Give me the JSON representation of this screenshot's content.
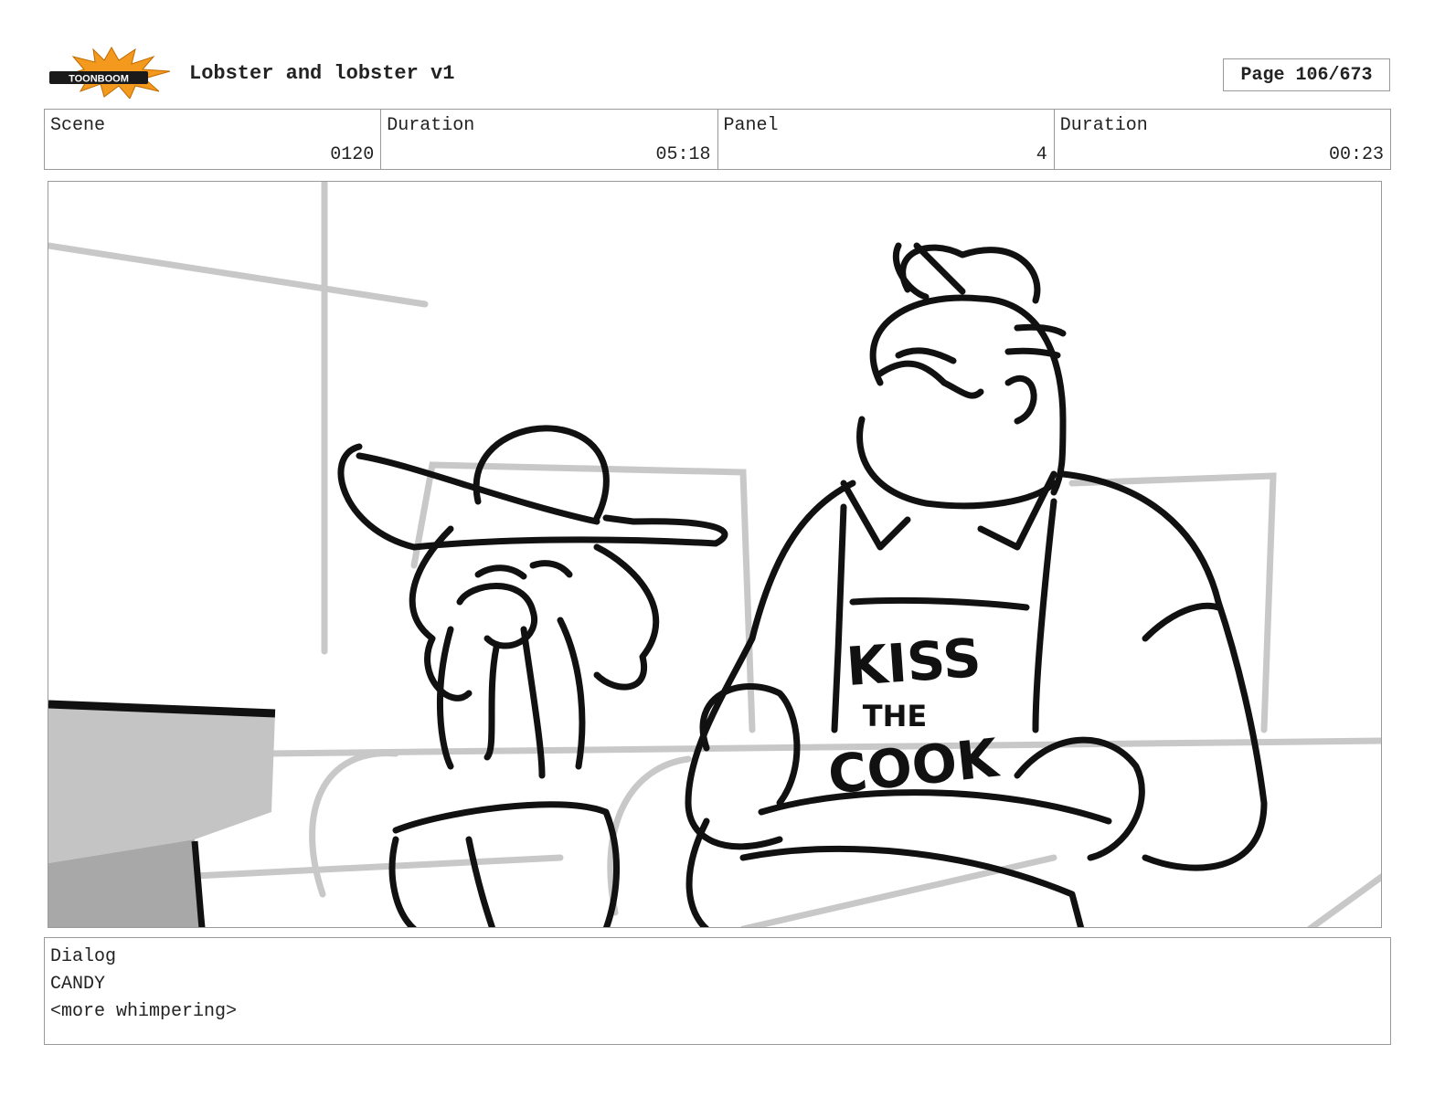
{
  "header": {
    "logo_text": "TOONBOOM",
    "project_title": "Lobster and lobster v1",
    "page_indicator": "Page 106/673"
  },
  "info": {
    "scene_label": "Scene",
    "scene_value": "0120",
    "scene_duration_label": "Duration",
    "scene_duration_value": "05:18",
    "panel_label": "Panel",
    "panel_value": "4",
    "panel_duration_label": "Duration",
    "panel_duration_value": "00:23"
  },
  "panel_art": {
    "apron_text_line1": "KISS",
    "apron_text_line2": "THE",
    "apron_text_line3": "COOK"
  },
  "dialog": {
    "label": "Dialog",
    "character": "CANDY",
    "line": "<more whimpering>"
  },
  "colors": {
    "logo_orange": "#f39a1e",
    "frame_border": "#9a9a9a",
    "sketch_gray": "#c8c8c8",
    "ink": "#111111"
  }
}
